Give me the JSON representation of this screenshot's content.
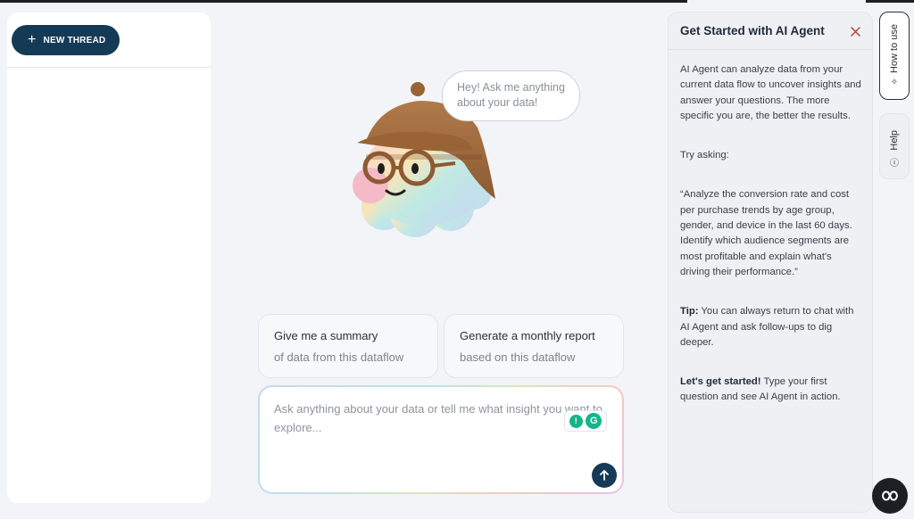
{
  "sidebar": {
    "new_thread_label": "NEW THREAD"
  },
  "mascot": {
    "bubble_text": "Hey! Ask me anything about your data!"
  },
  "suggestions": [
    {
      "line1": "Give me a summary",
      "line2": "of data from this dataflow"
    },
    {
      "line1": "Generate a monthly report",
      "line2": "based on this dataflow"
    }
  ],
  "chat_input": {
    "placeholder": "Ask anything about your data or tell me what insight you want to explore..."
  },
  "panel": {
    "title": "Get Started with AI Agent",
    "intro": "AI Agent can analyze data from your current data flow to uncover insights and answer your questions. The more specific you are, the better the results.",
    "try_asking": "Try asking:",
    "example": "“Analyze the conversion rate and cost per purchase trends by age group, gender, and device in the last 60 days. Identify which audience segments are most profitable and explain what's driving their performance.”",
    "tip_label": "Tip:",
    "tip_text": " You can always return to chat with AI Agent and ask follow-ups to dig deeper.",
    "start_label": "Let's get started!",
    "start_text": " Type your first question and see AI Agent in action."
  },
  "side_tabs": {
    "how_to_use": "How to use",
    "help": "Help"
  },
  "colors": {
    "primary": "#153a56",
    "accent_extension": "#15b58a"
  }
}
